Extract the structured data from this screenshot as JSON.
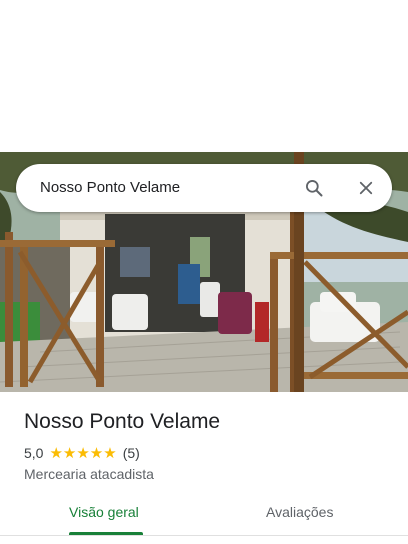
{
  "search": {
    "query": "Nosso Ponto Velame"
  },
  "place": {
    "name": "Nosso Ponto Velame",
    "rating": "5,0",
    "stars": "★★★★★",
    "review_count": "(5)",
    "category": "Mercearia atacadista"
  },
  "tabs": [
    {
      "label": "Visão geral",
      "active": true
    },
    {
      "label": "Avaliações",
      "active": false
    }
  ],
  "colors": {
    "accent": "#188038",
    "star": "#fbbc04",
    "text": "#202124"
  },
  "icons": {
    "search": "search-icon",
    "close": "close-icon"
  }
}
